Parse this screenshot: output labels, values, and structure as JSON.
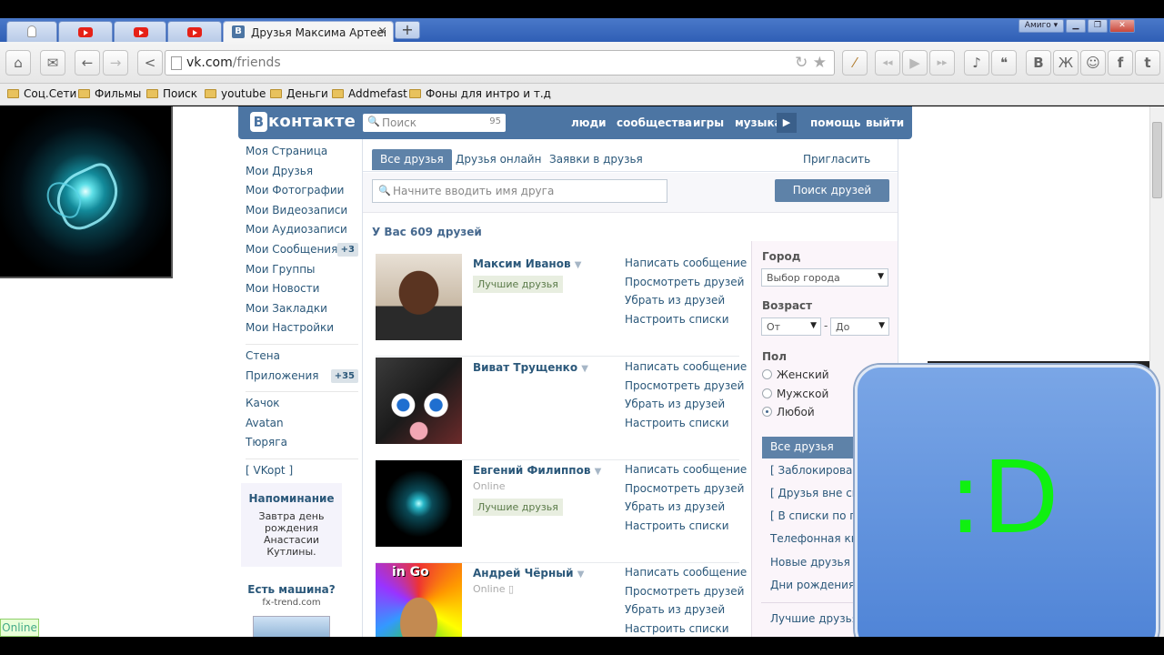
{
  "browser": {
    "tabs": [
      {
        "icon": "ghost-icon"
      },
      {
        "icon": "youtube-icon"
      },
      {
        "icon": "youtube-icon"
      },
      {
        "icon": "youtube-icon"
      },
      {
        "icon": "vk-icon",
        "title": "Друзья Максима Артеева |",
        "vk_letter": "В"
      }
    ],
    "tab_close": "×",
    "new_tab": "+",
    "profile_label": "Амиго ▾",
    "window_controls": {
      "minimize": "▁",
      "restore": "❐",
      "close": "✕"
    },
    "address": {
      "domain": "vk.com",
      "path": "/friends"
    },
    "toolbar_icons": [
      "home-icon",
      "mail-icon",
      "back-icon",
      "forward-icon",
      "share-icon",
      "reload-icon",
      "star-icon",
      "wand-icon",
      "rewind-icon",
      "play-icon",
      "fastforward-icon",
      "music-icon",
      "chat-icon",
      "vk-icon",
      "odnoklassniki-icon",
      "moimir-icon",
      "facebook-icon",
      "twitter-icon"
    ],
    "toolbar_glyphs": {
      "home": "⌂",
      "mail": "✉",
      "back": "←",
      "forward": "→",
      "share": "<",
      "reload": "↻",
      "star": "★",
      "wand": "⁄",
      "rewind": "◂◂",
      "play": "▶",
      "fastforward": "▸▸",
      "music": "♪",
      "chat": "❝",
      "vk": "B",
      "ok": "Ж",
      "mm": "☺",
      "fb": "f",
      "tw": "t"
    },
    "bookmarks": [
      "Соц.Сети",
      "Фильмы",
      "Поиск",
      "youtube",
      "Деньги",
      "Addmefast",
      "Фоны для интро и т.д"
    ]
  },
  "vk": {
    "logo_letter": "В",
    "logo_text": "контакте",
    "search_placeholder": "Поиск",
    "search_count": "95",
    "search_icon": "🔍",
    "nav": [
      "люди",
      "сообщества",
      "игры",
      "музыка",
      "помощь",
      "выйти"
    ],
    "play_glyph": "▶",
    "left_menu": [
      {
        "label": "Моя Страница"
      },
      {
        "label": "Мои Друзья"
      },
      {
        "label": "Мои Фотографии"
      },
      {
        "label": "Мои Видеозаписи"
      },
      {
        "label": "Мои Аудиозаписи"
      },
      {
        "label": "Мои Сообщения",
        "badge": "+3"
      },
      {
        "label": "Мои Группы"
      },
      {
        "label": "Мои Новости"
      },
      {
        "label": "Мои Закладки"
      },
      {
        "label": "Мои Настройки"
      }
    ],
    "left_menu_2": [
      {
        "label": "Стена"
      },
      {
        "label": "Приложения",
        "badge": "+35"
      }
    ],
    "left_menu_3": [
      {
        "label": "Качок"
      },
      {
        "label": "Avatan"
      },
      {
        "label": "Тюряга"
      }
    ],
    "vkopt": "[ VKopt ]",
    "reminder": {
      "title": "Напоминание",
      "body": "Завтра день рождения Анастасии Кутлины."
    },
    "ad": {
      "title": "Есть машина?",
      "site": "fx-trend.com"
    },
    "online": "Online",
    "tabs": [
      "Все друзья",
      "Друзья онлайн",
      "Заявки в друзья"
    ],
    "invite": "Пригласить друга",
    "friend_search_placeholder": "Начните вводить имя друга",
    "search_friends_button": "Поиск друзей",
    "friends_count": "У Вас 609 друзей",
    "friends": [
      {
        "name": "Максим Иванов",
        "status": "",
        "label": "Лучшие друзья"
      },
      {
        "name": "Виват Трущенко",
        "status": "",
        "label": ""
      },
      {
        "name": "Евгений Филиппов",
        "status": "Online",
        "label": "Лучшие друзья"
      },
      {
        "name": "Андрей Чёрный",
        "status": "Online",
        "label": ""
      }
    ],
    "friend_actions": [
      "Написать сообщение",
      "Просмотреть друзей",
      "Убрать из друзей",
      "Настроить списки"
    ],
    "filters": {
      "city_label": "Город",
      "city_placeholder": "Выбор города",
      "age_label": "Возраст",
      "age_from": "От",
      "age_to": "До",
      "age_dash": "-",
      "sex_label": "Пол",
      "sex_options": [
        "Женский",
        "Мужской",
        "Любой"
      ],
      "sex_selected": "Любой",
      "lists": [
        "Все друзья",
        "[ Заблокированные ]",
        "[ Друзья вне списков ]",
        "[ В списки по полу ]",
        "Телефонная книга",
        "Новые друзья",
        "Дни рождения",
        "Лучшие друзья"
      ]
    }
  },
  "overlay": {
    "text": ":D"
  }
}
